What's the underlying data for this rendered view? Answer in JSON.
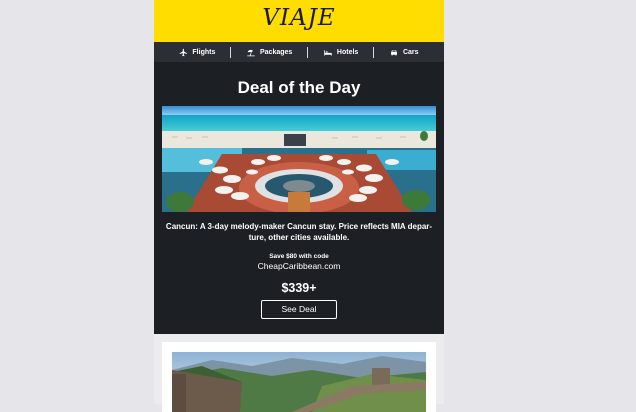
{
  "header": {
    "brand": "VIAJE"
  },
  "nav": {
    "items": [
      {
        "label": "Flights",
        "icon": "airplane-icon"
      },
      {
        "label": "Packages",
        "icon": "beach-umbrella-icon"
      },
      {
        "label": "Hotels",
        "icon": "bed-icon"
      },
      {
        "label": "Cars",
        "icon": "car-icon"
      }
    ]
  },
  "deal": {
    "title": "Deal of the Day",
    "description": "Cancun: A 3-day melody-maker Cancun stay. Price reflects MIA depar-ture, other cities available.",
    "promo_label": "Save $80 with code",
    "promo_code": "CheapCaribbean.com",
    "price": "$339+",
    "cta_label": "See Deal"
  },
  "colors": {
    "header_bg": "#ffdd00",
    "nav_bg": "#2b2f34",
    "deal_bg": "#1c1f23",
    "page_bg": "#e6e6ea"
  }
}
